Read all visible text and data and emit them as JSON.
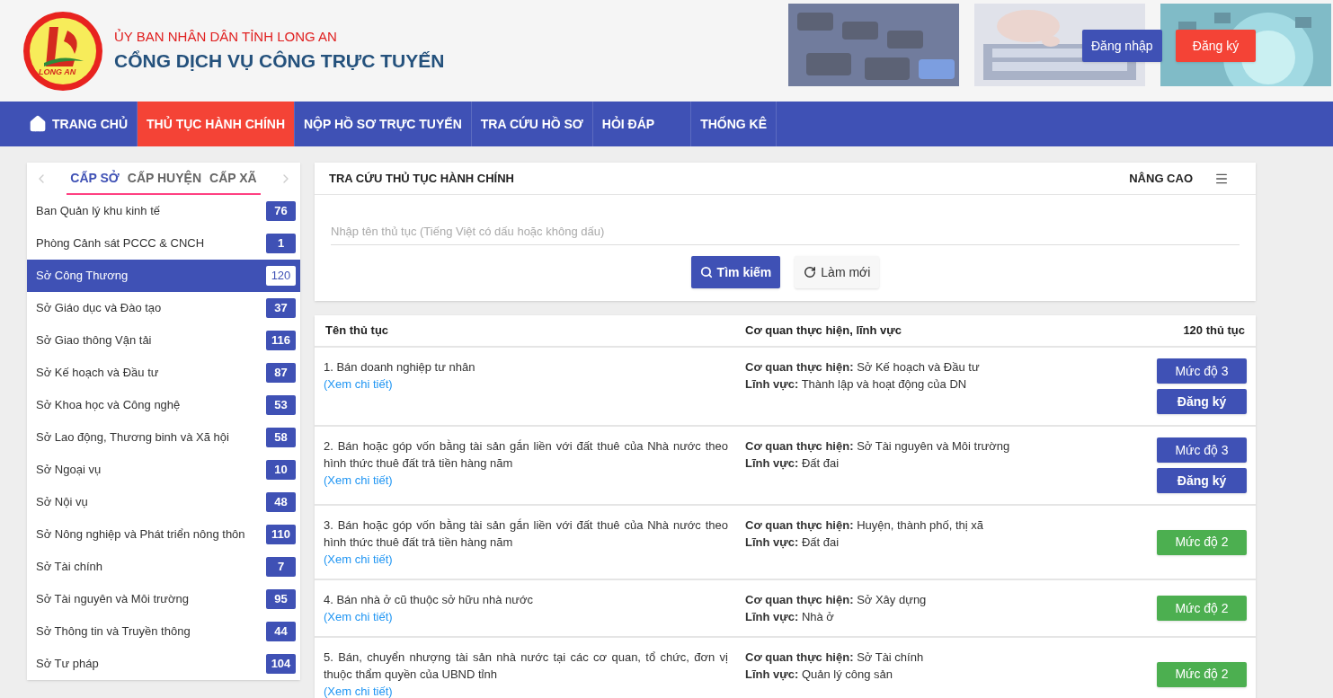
{
  "header": {
    "logo_text": "LONG AN",
    "org": "ỦY BAN NHÂN DÂN TỈNH LONG AN",
    "title": "CỔNG DỊCH VỤ CÔNG TRỰC TUYẾN",
    "login": "Đăng nhập",
    "register": "Đăng ký"
  },
  "nav": [
    {
      "label": "TRANG CHỦ",
      "selected": false,
      "kind": "home"
    },
    {
      "label": "THỦ TỤC HÀNH CHÍNH",
      "selected": true,
      "kind": "link"
    },
    {
      "label": "NỘP HỒ SƠ TRỰC TUYẾN",
      "selected": false,
      "kind": "link"
    },
    {
      "label": "TRA CỨU HỒ SƠ",
      "selected": false,
      "kind": "link"
    },
    {
      "label": "HỎI ĐÁP",
      "selected": false,
      "kind": "link"
    },
    {
      "label": "THỐNG KÊ",
      "selected": false,
      "kind": "link"
    }
  ],
  "sidebar": {
    "tabs": [
      {
        "label": "CẤP SỞ",
        "selected": true
      },
      {
        "label": "CẤP HUYỆN",
        "selected": false
      },
      {
        "label": "CẤP XÃ",
        "selected": false
      }
    ],
    "items": [
      {
        "label": "Ban Quản lý khu kinh tế",
        "count": "76",
        "selected": false
      },
      {
        "label": "Phòng Cảnh sát PCCC & CNCH",
        "count": "1",
        "selected": false
      },
      {
        "label": "Sở Công Thương",
        "count": "120",
        "selected": true
      },
      {
        "label": "Sở Giáo dục và Đào tạo",
        "count": "37",
        "selected": false
      },
      {
        "label": "Sở Giao thông Vận tải",
        "count": "116",
        "selected": false
      },
      {
        "label": "Sở Kế hoạch và Đầu tư",
        "count": "87",
        "selected": false
      },
      {
        "label": "Sở Khoa học và Công nghệ",
        "count": "53",
        "selected": false
      },
      {
        "label": "Sở Lao động, Thương binh và Xã hội",
        "count": "58",
        "selected": false
      },
      {
        "label": "Sở Ngoại vụ",
        "count": "10",
        "selected": false
      },
      {
        "label": "Sở Nội vụ",
        "count": "48",
        "selected": false
      },
      {
        "label": "Sở Nông nghiệp và Phát triển nông thôn",
        "count": "110",
        "selected": false
      },
      {
        "label": "Sở Tài chính",
        "count": "7",
        "selected": false
      },
      {
        "label": "Sở Tài nguyên và Môi trường",
        "count": "95",
        "selected": false
      },
      {
        "label": "Sở Thông tin và Truyền thông",
        "count": "44",
        "selected": false
      },
      {
        "label": "Sở Tư pháp",
        "count": "104",
        "selected": false
      }
    ]
  },
  "search": {
    "title": "TRA CỨU THỦ TỤC HÀNH CHÍNH",
    "advanced": "NÂNG CAO",
    "placeholder": "Nhập tên thủ tục (Tiếng Việt có dấu hoặc không dấu)",
    "search_button": "Tìm kiếm",
    "reset_button": "Làm mới"
  },
  "table": {
    "columns": [
      "Tên thủ tục",
      "Cơ quan thực hiện, lĩnh vực",
      "120 thủ tục"
    ],
    "rows": [
      {
        "name": "1. Bán doanh nghiệp tư nhân",
        "link": "(Xem chi tiết)",
        "agency_label": "Cơ quan thực hiện:",
        "field_label": "Lĩnh vực:",
        "agency": "Sở Kế hoạch và Đầu tư",
        "field": "Thành lập và hoạt động của DN",
        "tag": "Mức độ 3",
        "color": "#3f51b5",
        "register": "Đăng ký"
      },
      {
        "name": "2. Bán hoặc góp vốn bằng tài sản gắn liền với đất thuê của Nhà nước theo hình thức thuê đất trả tiền hàng năm",
        "link": "(Xem chi tiết)",
        "agency_label": "Cơ quan thực hiện:",
        "field_label": "Lĩnh vực:",
        "agency": "Sở Tài nguyên và Môi trường",
        "field": "Đất đai",
        "tag": "Mức độ 3",
        "color": "#3f51b5",
        "register": "Đăng ký"
      },
      {
        "name": "3. Bán hoặc góp vốn bằng tài sản gắn liền với đất thuê của Nhà nước theo hình thức thuê đất trả tiền hàng năm",
        "link": "(Xem chi tiết)",
        "agency_label": "Cơ quan thực hiện:",
        "field_label": "Lĩnh vực:",
        "agency": "Huyện, thành phố, thị xã",
        "field": "Đất đai",
        "tag": "Mức độ 2",
        "color": "#4caf50"
      },
      {
        "name": "4. Bán nhà ở cũ thuộc sở hữu nhà nước",
        "link": "(Xem chi tiết)",
        "agency_label": "Cơ quan thực hiện:",
        "field_label": "Lĩnh vực:",
        "agency": "Sở Xây dựng",
        "field": "Nhà ở",
        "tag": "Mức độ 2",
        "color": "#4caf50"
      },
      {
        "name": "5. Bán, chuyển nhượng tài sản nhà nước tại các cơ quan, tổ chức, đơn vị thuộc thẩm quyền của UBND tỉnh",
        "link": "(Xem chi tiết)",
        "agency_label": "Cơ quan thực hiện:",
        "field_label": "Lĩnh vực:",
        "agency": "Sở Tài chính",
        "field": "Quản lý công sản",
        "tag": "Mức độ 2",
        "color": "#4caf50"
      }
    ]
  }
}
